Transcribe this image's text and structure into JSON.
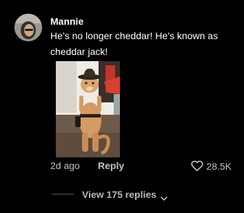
{
  "comment": {
    "username": "Mannie",
    "text": "He’s no longer cheddar! He’s known as cheddar jack!",
    "timestamp": "2d ago",
    "reply_label": "Reply",
    "likes": "28.5K"
  },
  "replies": {
    "label": "View 175 replies"
  },
  "icons": {
    "like": "heart-outline-icon",
    "expand": "chevron-down-icon"
  },
  "colors": {
    "background": "#000000",
    "text": "#ffffff",
    "muted": "#c2c2c2"
  }
}
